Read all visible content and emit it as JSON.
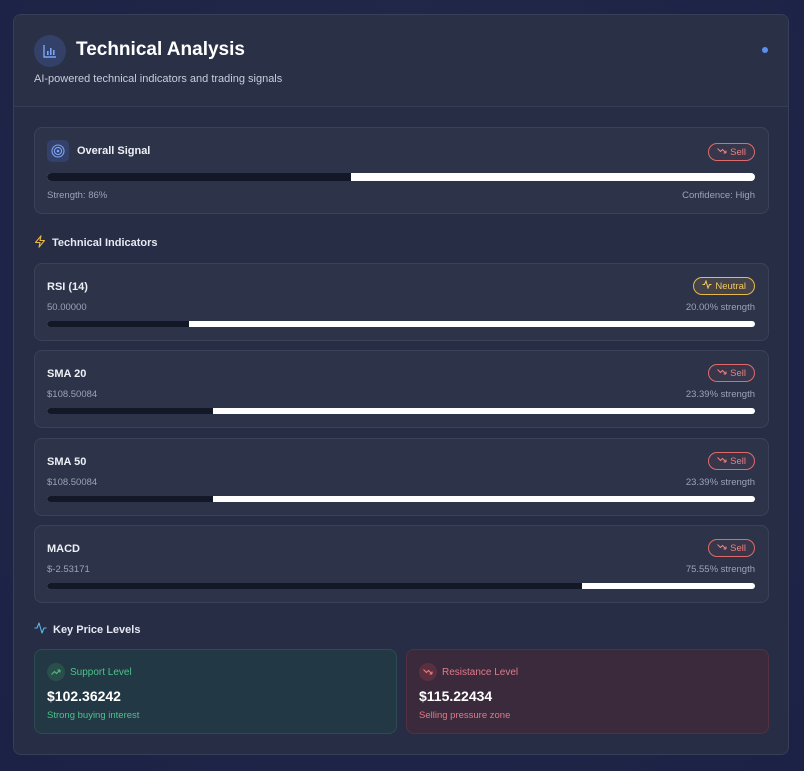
{
  "header": {
    "title": "Technical Analysis",
    "subtitle": "AI-powered technical indicators and trading signals",
    "icon": "bar-chart-icon",
    "status_dot_color": "#5b8ef0"
  },
  "overall": {
    "title": "Overall Signal",
    "icon": "target-icon",
    "signal": "Sell",
    "strength_label": "Strength: 86%",
    "confidence_label": "Confidence: High",
    "bar_fraction": 0.43
  },
  "indicators_section": {
    "title": "Technical Indicators",
    "icon": "lightning-icon"
  },
  "indicators": [
    {
      "name": "RSI (14)",
      "value": "50.00000",
      "strength": "20.00% strength",
      "signal": "Neutral",
      "bar_fraction": 0.2
    },
    {
      "name": "SMA 20",
      "value": "$108.50084",
      "strength": "23.39% strength",
      "signal": "Sell",
      "bar_fraction": 0.2339
    },
    {
      "name": "SMA 50",
      "value": "$108.50084",
      "strength": "23.39% strength",
      "signal": "Sell",
      "bar_fraction": 0.2339
    },
    {
      "name": "MACD",
      "value": "$-2.53171",
      "strength": "75.55% strength",
      "signal": "Sell",
      "bar_fraction": 0.7555
    }
  ],
  "levels_section": {
    "title": "Key Price Levels",
    "icon": "pulse-icon"
  },
  "support": {
    "label": "Support Level",
    "value": "$102.36242",
    "description": "Strong buying interest",
    "color": "#4cc38a"
  },
  "resistance": {
    "label": "Resistance Level",
    "value": "$115.22434",
    "description": "Selling pressure zone",
    "color": "#e06a7a"
  },
  "colors": {
    "sell": "#e06a6a",
    "neutral": "#e8b84a",
    "accent": "#5b8ef0"
  }
}
